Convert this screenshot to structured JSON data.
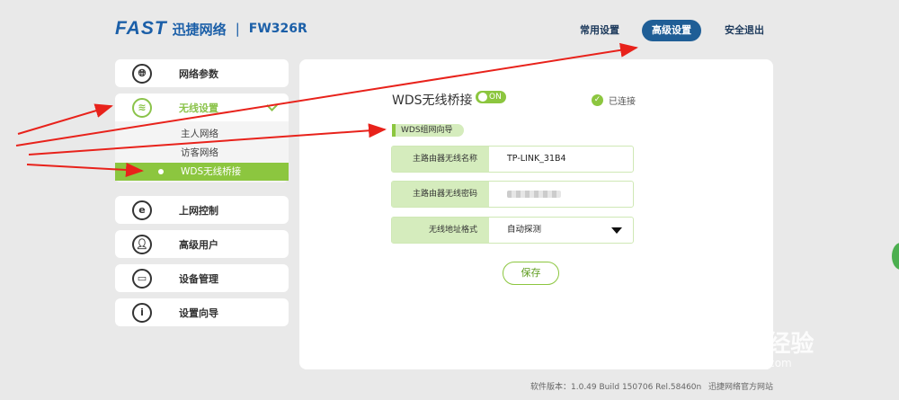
{
  "brand": {
    "logo_text": "FAST",
    "logo_cn": "迅捷网络",
    "separator": "|",
    "model": "FW326R"
  },
  "topnav": {
    "common": "常用设置",
    "advanced": "高级设置",
    "logout": "安全退出"
  },
  "sidebar": {
    "items": [
      {
        "label": "网络参数"
      },
      {
        "label": "无线设置"
      },
      {
        "label": "上网控制"
      },
      {
        "label": "高级用户"
      },
      {
        "label": "设备管理"
      },
      {
        "label": "设置向导"
      }
    ],
    "sub_items": [
      {
        "label": "主人网络"
      },
      {
        "label": "访客网络"
      },
      {
        "label": "WDS无线桥接"
      }
    ]
  },
  "main": {
    "title": "WDS无线桥接",
    "toggle_label": "ON",
    "status": "已连接",
    "wizard": "WDS组网向导",
    "fields": [
      {
        "label": "主路由器无线名称",
        "value": "TP-LINK_31B4"
      },
      {
        "label": "主路由器无线密码",
        "value": ""
      },
      {
        "label": "无线地址格式",
        "value": "自动探测"
      }
    ],
    "save": "保存"
  },
  "footer": {
    "version": "软件版本：1.0.49 Build 150706 Rel.58460n",
    "site": "迅捷网络官方网站"
  },
  "watermark": {
    "main": "Baidu经验",
    "sub": "jingyan.baidu.com"
  },
  "colors": {
    "brand_blue": "#1b5fa8",
    "accent_green": "#8cc63f",
    "arrow_red": "#e8221b"
  }
}
